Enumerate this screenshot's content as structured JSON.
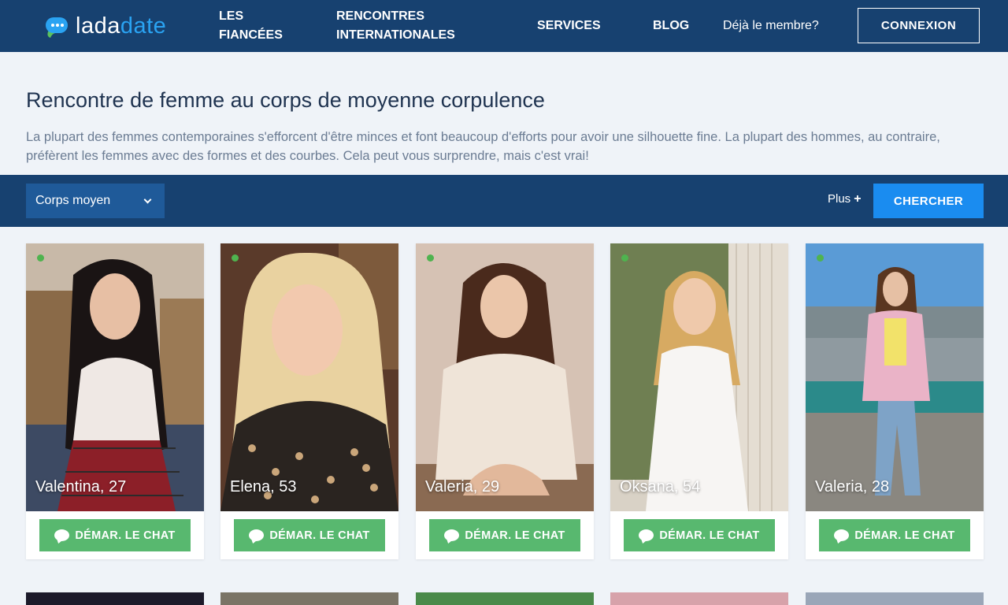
{
  "header": {
    "logo_part1": "lada",
    "logo_part2": "date",
    "nav": {
      "fiancees": "LES FIANCÉES",
      "rencontres": "RENCONTRES INTERNATIONALES",
      "services": "SERVICES",
      "blog": "BLOG"
    },
    "member_text": "Déjà le membre?",
    "login_label": "CONNEXION"
  },
  "intro": {
    "title": "Rencontre de femme au corps de moyenne corpulence",
    "description": "La plupart des femmes contemporaines s'efforcent d'être minces et font beaucoup d'efforts pour avoir une silhouette fine. La plupart des hommes, au contraire, préfèrent les femmes avec des formes et des courbes. Cela peut vous surprendre, mais c'est vrai!"
  },
  "filter": {
    "body_type_selected": "Corps moyen",
    "more_label": "Plus",
    "more_icon": "+",
    "search_label": "CHERCHER"
  },
  "profiles": [
    {
      "name": "Valentina, 27",
      "online": true,
      "chat_label": "DÉMAR. LE CHAT"
    },
    {
      "name": "Elena, 53",
      "online": true,
      "chat_label": "DÉMAR. LE CHAT"
    },
    {
      "name": "Valeria, 29",
      "online": true,
      "chat_label": "DÉMAR. LE CHAT"
    },
    {
      "name": "Oksana, 54",
      "online": true,
      "chat_label": "DÉMAR. LE CHAT"
    },
    {
      "name": "Valeria, 28",
      "online": true,
      "chat_label": "DÉMAR. LE CHAT"
    }
  ],
  "colors": {
    "header_bg": "#174170",
    "page_bg": "#eff3f8",
    "accent_blue": "#1a8cf0",
    "chat_green": "#58b86f",
    "online_green": "#4fb34f"
  }
}
